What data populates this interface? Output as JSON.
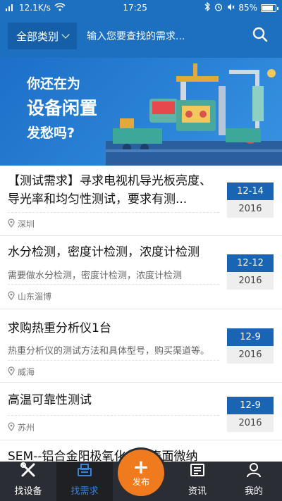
{
  "status_bar": {
    "speed": "12.1K/s",
    "time": "17:25",
    "battery": "85%",
    "battery_level": 0.85
  },
  "search": {
    "category": "全部类别",
    "placeholder": "输入您要查找的需求..."
  },
  "banner": {
    "line1": "你还在为",
    "line2": "设备闲置",
    "line3": "发愁吗?"
  },
  "items": [
    {
      "title": "【测试需求】寻求电视机导光板亮度、导光率和均匀性测试，要求有测...",
      "description": "",
      "location": "深圳",
      "date": "12-14",
      "year": "2016"
    },
    {
      "title": "水分检测，密度计检测，浓度计检测",
      "description": "需要做水分检测，密度计检测，浓度计检测",
      "location": "山东淄博",
      "date": "12-12",
      "year": "2016"
    },
    {
      "title": "求购热重分析仪1台",
      "description": "热重分析仪的测试方法和具体型号，购买渠道等。",
      "location": "威海",
      "date": "12-9",
      "year": "2016"
    },
    {
      "title": "高温可靠性测试",
      "description": "",
      "location": "苏州",
      "date": "12-9",
      "year": "2016"
    },
    {
      "title": "SEM--铝合金阳极氧化之后表面微纳",
      "description": "",
      "location": "",
      "date": "",
      "year": ""
    }
  ],
  "nav": {
    "tabs": [
      {
        "label": "找设备",
        "icon": "tools-icon"
      },
      {
        "label": "找需求",
        "icon": "demand-icon"
      },
      {
        "label": "发布",
        "icon": "plus-icon"
      },
      {
        "label": "资讯",
        "icon": "news-icon"
      },
      {
        "label": "我的",
        "icon": "user-icon"
      }
    ],
    "active_color": "#3b82d6",
    "publish_color": "#f07a1e"
  }
}
